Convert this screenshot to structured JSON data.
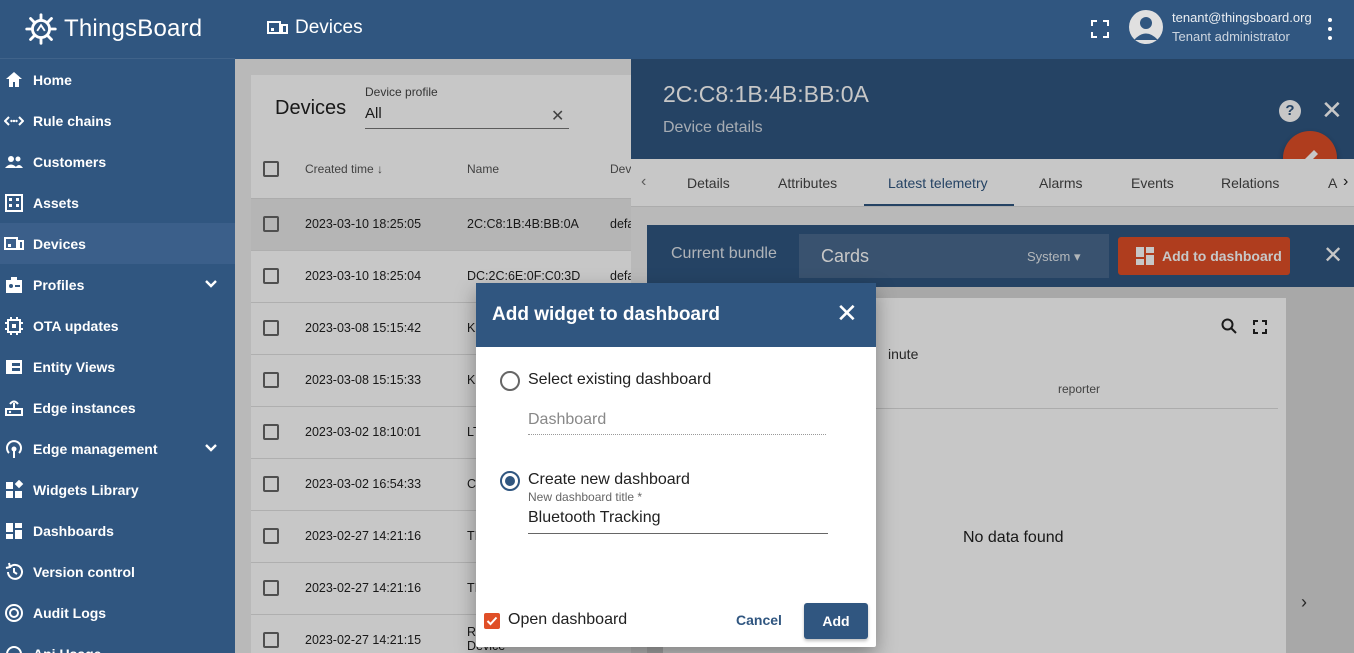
{
  "app": {
    "name": "ThingsBoard",
    "page_title": "Devices"
  },
  "user": {
    "email": "tenant@thingsboard.org",
    "role": "Tenant administrator"
  },
  "sidebar": {
    "items": [
      {
        "label": "Home",
        "icon": "home-icon"
      },
      {
        "label": "Rule chains",
        "icon": "rule-chain-icon"
      },
      {
        "label": "Customers",
        "icon": "customers-icon"
      },
      {
        "label": "Assets",
        "icon": "assets-icon"
      },
      {
        "label": "Devices",
        "icon": "devices-icon",
        "active": true
      },
      {
        "label": "Profiles",
        "icon": "profiles-icon",
        "expandable": true
      },
      {
        "label": "OTA updates",
        "icon": "ota-icon"
      },
      {
        "label": "Entity Views",
        "icon": "entity-views-icon"
      },
      {
        "label": "Edge instances",
        "icon": "edge-icon"
      },
      {
        "label": "Edge management",
        "icon": "edge-management-icon",
        "expandable": true
      },
      {
        "label": "Widgets Library",
        "icon": "widgets-icon"
      },
      {
        "label": "Dashboards",
        "icon": "dashboards-icon"
      },
      {
        "label": "Version control",
        "icon": "history-icon"
      },
      {
        "label": "Audit Logs",
        "icon": "audit-icon"
      },
      {
        "label": "Api Usage",
        "icon": "api-usage-icon"
      }
    ]
  },
  "devices": {
    "title": "Devices",
    "filter_label": "Device profile",
    "filter_value": "All",
    "columns": {
      "created": "Created time",
      "name": "Name",
      "profile": "Dev"
    },
    "rows": [
      {
        "created": "2023-03-10 18:25:05",
        "name": "2C:C8:1B:4B:BB:0A",
        "profile": "defa",
        "selected": true
      },
      {
        "created": "2023-03-10 18:25:04",
        "name": "DC:2C:6E:0F:C0:3D",
        "profile": "defa"
      },
      {
        "created": "2023-03-08 15:15:42",
        "name": "K",
        "profile": ""
      },
      {
        "created": "2023-03-08 15:15:33",
        "name": "K",
        "profile": ""
      },
      {
        "created": "2023-03-02 18:10:01",
        "name": "LT",
        "profile": ""
      },
      {
        "created": "2023-03-02 16:54:33",
        "name": "C",
        "profile": ""
      },
      {
        "created": "2023-02-27 14:21:16",
        "name": "TI",
        "profile": ""
      },
      {
        "created": "2023-02-27 14:21:16",
        "name": "TI",
        "profile": ""
      },
      {
        "created": "2023-02-27 14:21:15",
        "name": "R",
        "profile": ""
      }
    ],
    "last_row_extra": "Device"
  },
  "details": {
    "device_name": "2C:C8:1B:4B:BB:0A",
    "subtitle": "Device details",
    "help": "?",
    "tabs": [
      "Details",
      "Attributes",
      "Latest telemetry",
      "Alarms",
      "Events",
      "Relations",
      "A"
    ],
    "active_tab": "Latest telemetry",
    "bundle_label": "Current bundle",
    "bundle_value": "Cards",
    "bundle_scope": "System",
    "add_to_dashboard": "Add to dashboard",
    "widget": {
      "partial_text": "inute",
      "column": "reporter",
      "empty": "No data found"
    }
  },
  "dialog": {
    "title": "Add widget to dashboard",
    "option_existing": "Select existing dashboard",
    "existing_placeholder": "Dashboard",
    "option_new": "Create new dashboard",
    "new_title_label": "New dashboard title *",
    "new_title_value": "Bluetooth Tracking",
    "open_dashboard": "Open dashboard",
    "open_dashboard_checked": true,
    "selected_option": "new",
    "cancel": "Cancel",
    "add": "Add"
  },
  "colors": {
    "primary": "#305680",
    "accent": "#e04f27"
  }
}
